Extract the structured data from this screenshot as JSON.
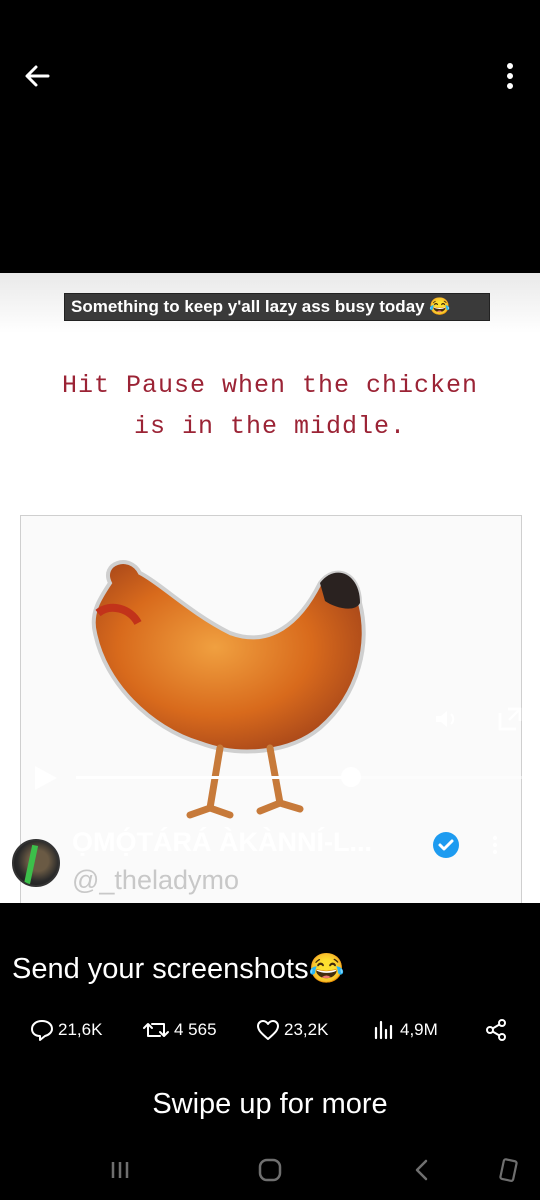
{
  "video": {
    "caption": "Something to keep y'all lazy ass busy today 😂",
    "headline_line1": "Hit Pause when the chicken",
    "headline_line2": "is in the middle.",
    "progress": 0.61
  },
  "author": {
    "display_name": "ỌMỌ́TÁRÁ ÀKÀNNÍ-L...",
    "handle": "@_theladymo"
  },
  "tweet": {
    "text": "Send your screenshots😂"
  },
  "actions": {
    "replies": "21,6K",
    "reposts": "4 565",
    "likes": "23,2K",
    "views": "4,9M"
  },
  "footer": {
    "swipe_hint": "Swipe up for more"
  },
  "icons": [
    "back-arrow-icon",
    "more-vertical-icon",
    "volume-icon",
    "expand-icon",
    "play-icon",
    "verified-badge-icon",
    "reply-icon",
    "repost-icon",
    "like-icon",
    "views-icon",
    "share-icon",
    "recents-icon",
    "home-icon",
    "back-icon",
    "rotate-icon"
  ],
  "colors": {
    "background": "#000000",
    "headline_red": "#9b2335",
    "verified_blue": "#1d9bf0",
    "handle_gray": "#c8c8c8"
  }
}
